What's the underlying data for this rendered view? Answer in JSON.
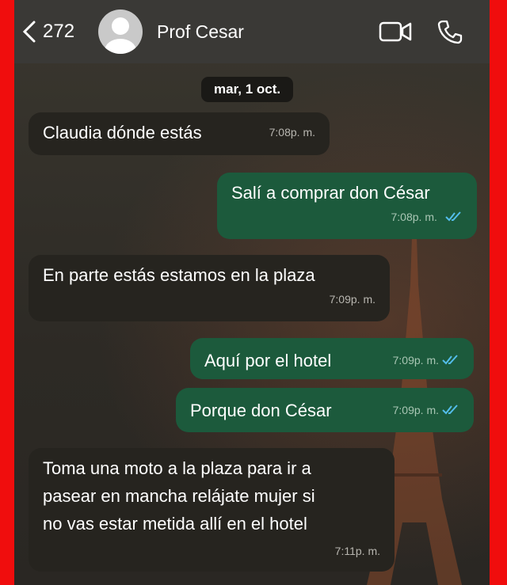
{
  "header": {
    "back_count": "272",
    "contact_name": "Prof Cesar"
  },
  "date_divider": "mar, 1 oct.",
  "messages": [
    {
      "text": "Claudia dónde estás",
      "time": "7:08p. m."
    },
    {
      "text": "Salí a comprar don César",
      "time": "7:08p. m."
    },
    {
      "text": "En parte estás estamos en la plaza",
      "time": "7:09p. m."
    },
    {
      "text": "Aquí por el hotel",
      "time": "7:09p. m."
    },
    {
      "text": "Porque don César",
      "time": "7:09p. m."
    },
    {
      "line1": "Toma una moto a la plaza para ir a",
      "line2": "pasear en mancha relájate mujer si",
      "line3": "no vas estar metida allí en el hotel",
      "time": "7:11p. m."
    }
  ],
  "colors": {
    "incoming": "#26241f",
    "outgoing": "#1c5a3c",
    "read_ticks": "#53bdeb"
  },
  "icons": [
    "back-chevron-icon",
    "avatar-icon",
    "video-call-icon",
    "phone-icon",
    "double-check-icon"
  ]
}
